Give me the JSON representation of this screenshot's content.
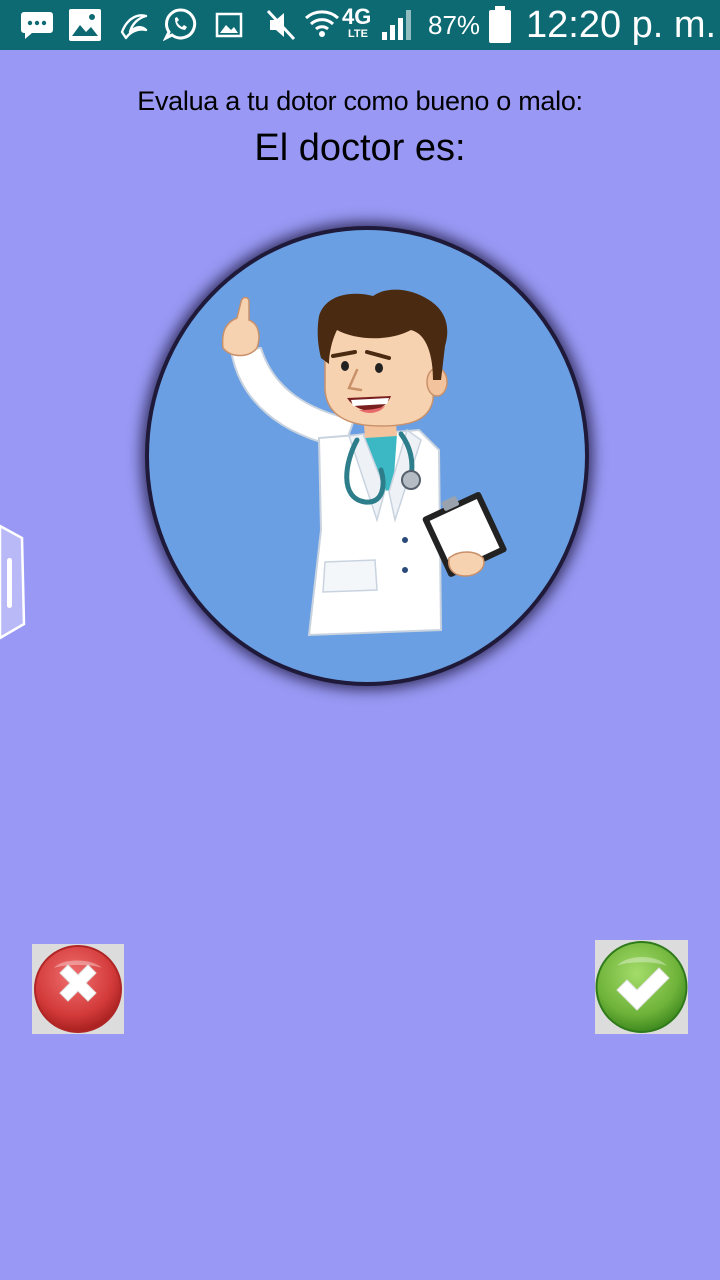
{
  "status_bar": {
    "network_label": "4G",
    "network_sub": "LTE",
    "battery_percent": "87%",
    "time": "12:20 p. m.",
    "icons": [
      "messages-icon",
      "gallery-icon",
      "bird-app-icon",
      "whatsapp-icon",
      "image-icon",
      "mute-icon",
      "wifi-icon",
      "signal-icon",
      "battery-icon"
    ]
  },
  "header": {
    "subtitle": "Evalua a tu dotor como bueno o malo:",
    "title": "El doctor es:"
  },
  "doctor_image": {
    "description_icon": "doctor-illustration"
  },
  "actions": {
    "bad_icon": "x-icon",
    "good_icon": "check-icon"
  },
  "colors": {
    "background": "#9999f5",
    "status_bar": "#0d6a73",
    "circle": "#6a9fe3",
    "bad": "#d33a3a",
    "good": "#6fb33a"
  }
}
